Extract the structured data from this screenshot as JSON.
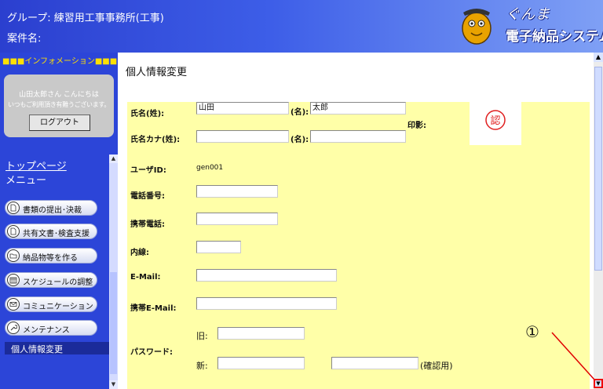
{
  "header": {
    "group": "グループ: 練習用工事事務所(工事)",
    "case_name": "案件名:",
    "logo_line1": "ぐんま",
    "logo_line2": "電子納品システム"
  },
  "sidebar": {
    "info_bar": "■■■インフォメーション■■■",
    "greeting": "山田太郎さん こんにちは",
    "thanks": "いつもご利用頂き有難うございます。",
    "logout": "ログアウト",
    "top_page": "トップページ",
    "menu_heading": "メニュー",
    "menu": [
      {
        "label": "書類の提出･決裁",
        "icon": "document-icon"
      },
      {
        "label": "共有文書･検査支援",
        "icon": "document-icon"
      },
      {
        "label": "納品物等を作る",
        "icon": "folder-icon"
      },
      {
        "label": "スケジュールの調整",
        "icon": "calendar-icon"
      },
      {
        "label": "コミュニケーション",
        "icon": "mail-icon"
      },
      {
        "label": "メンテナンス",
        "icon": "wrench-icon"
      }
    ],
    "active_item": "個人情報変更"
  },
  "main": {
    "title": "個人情報変更",
    "form": {
      "last_name_label": "氏名(姓):",
      "last_name_value": "山田",
      "first_name_label": "(名):",
      "first_name_value": "太郎",
      "kana_last_label": "氏名カナ(姓):",
      "kana_last_value": "",
      "kana_first_label": "(名):",
      "kana_first_value": "",
      "seal_label": "印影:",
      "seal_char": "認",
      "user_id_label": "ユーザID:",
      "user_id_value": "gen001",
      "phone_label": "電話番号:",
      "mobile_label": "携帯電話:",
      "ext_label": "内線:",
      "email_label": "E-Mail:",
      "mobile_email_label": "携帯E-Mail:",
      "password_label": "パスワード:",
      "old_label": "旧:",
      "new_label": "新:",
      "confirm_label": "(確認用)"
    }
  },
  "annotation": {
    "number": "①",
    "color": "#e00000"
  }
}
